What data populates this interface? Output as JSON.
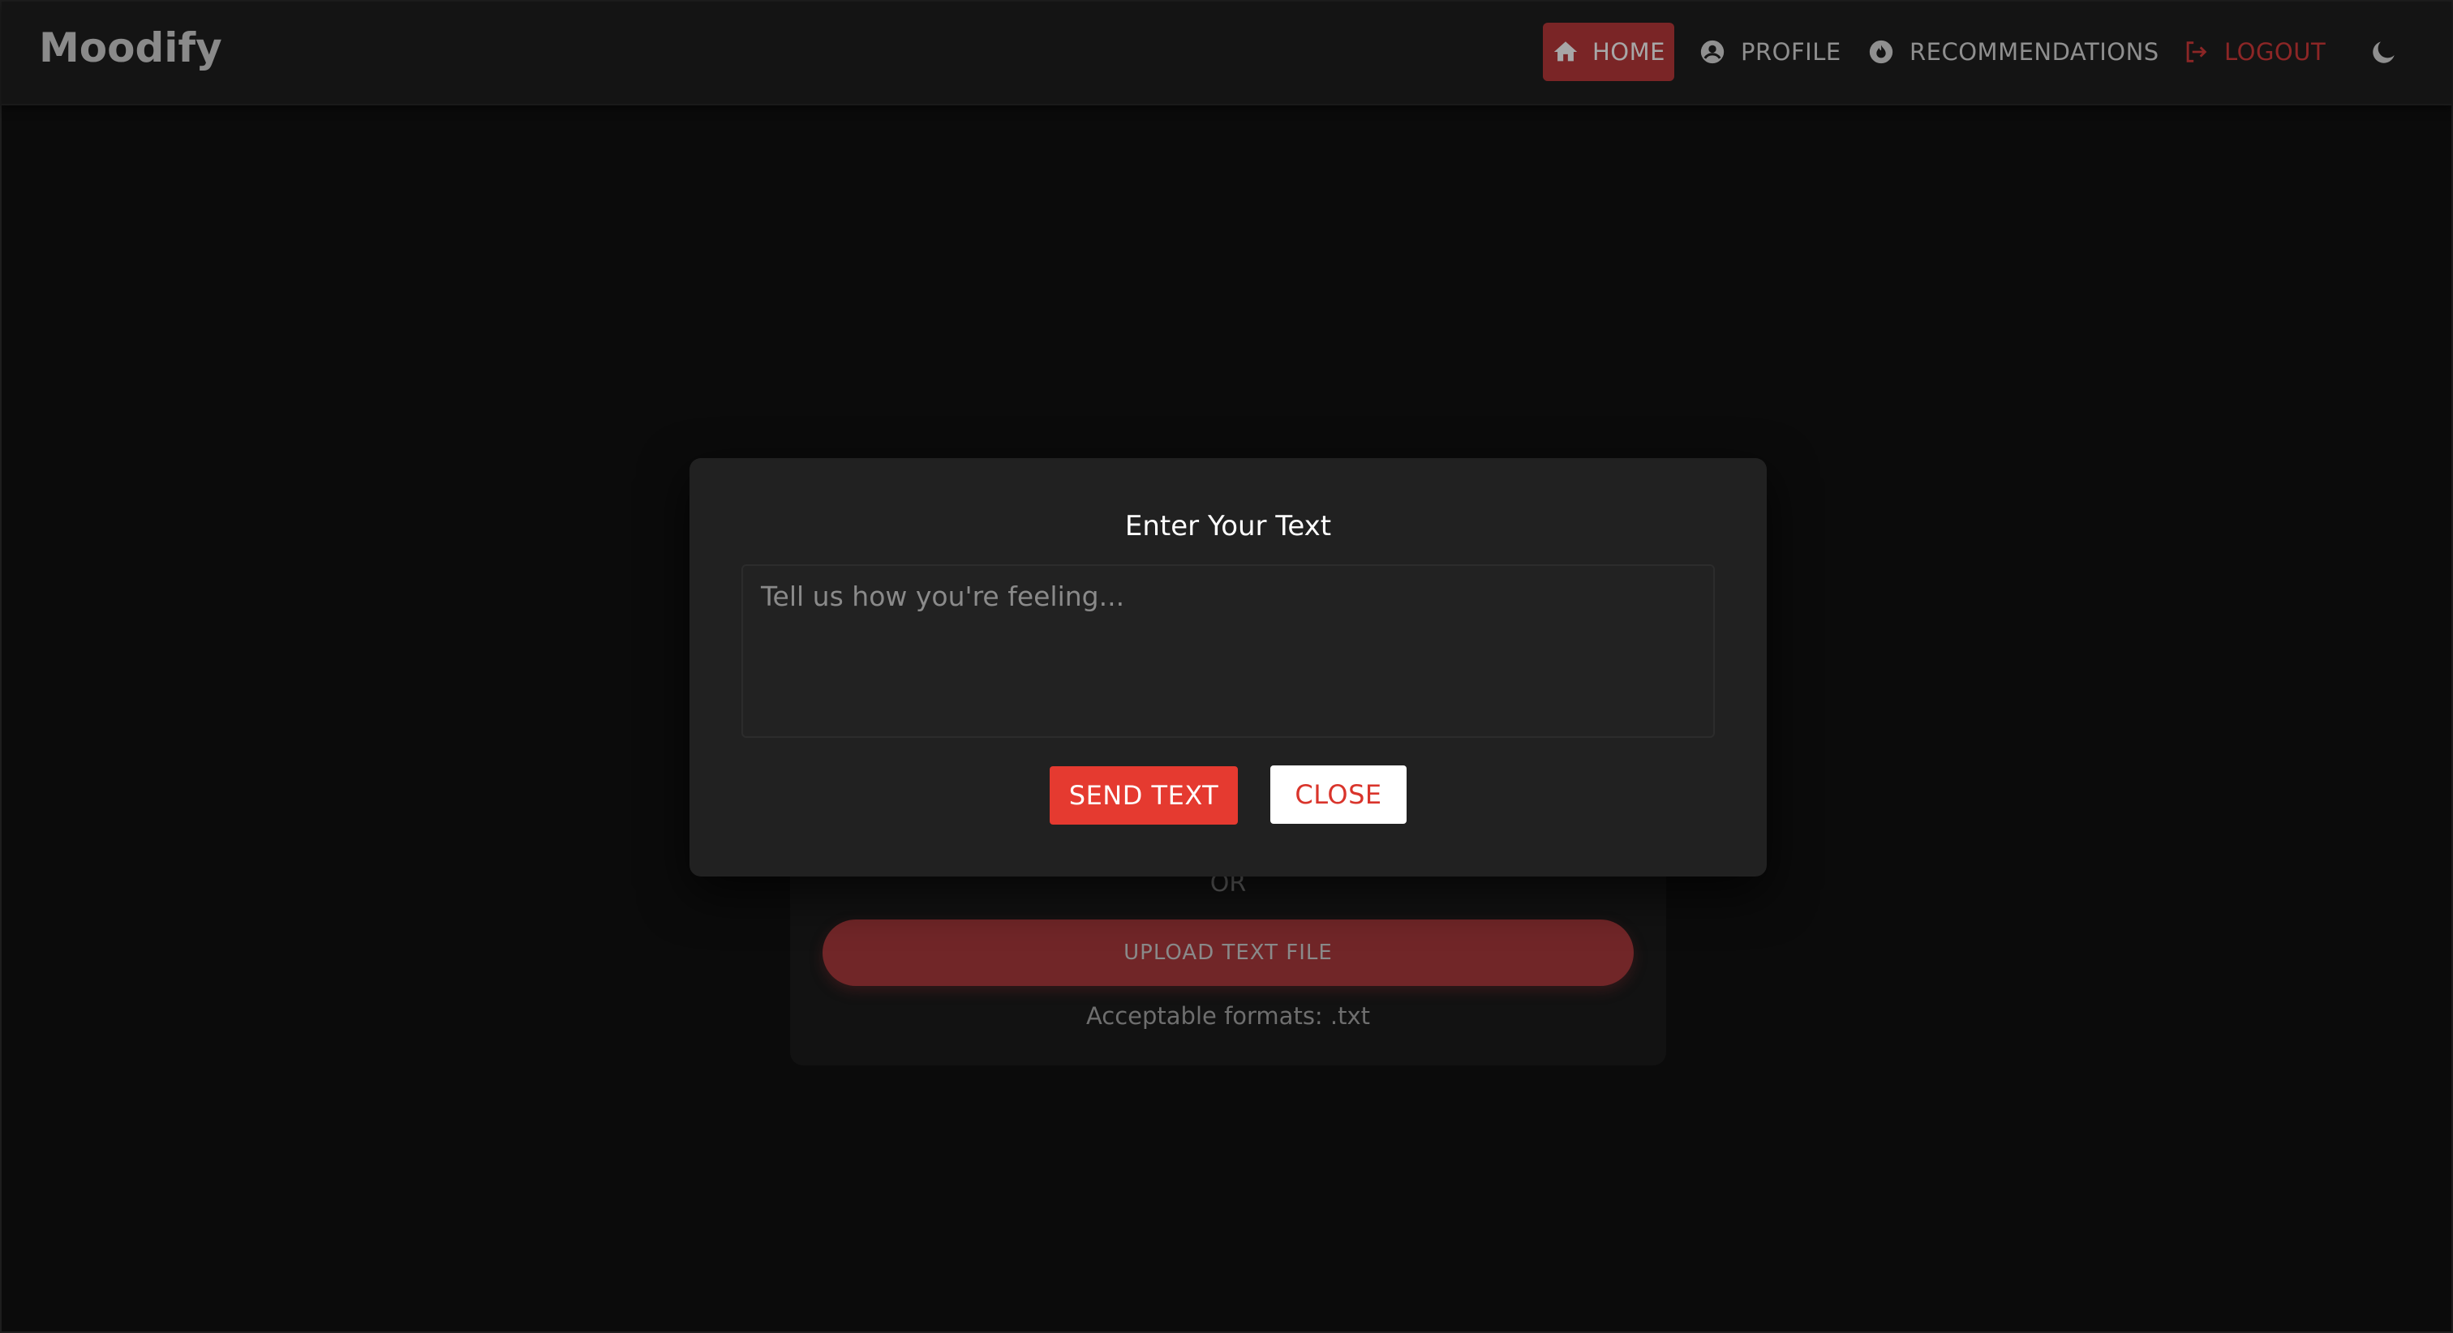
{
  "app": {
    "brand": "Moodify"
  },
  "nav": {
    "home": "HOME",
    "profile": "PROFILE",
    "recommendations": "RECOMMENDATIONS",
    "logout": "LOGOUT"
  },
  "background_card": {
    "or_label": "OR",
    "upload_label": "UPLOAD TEXT FILE",
    "formats_label": "Acceptable formats: .txt"
  },
  "modal": {
    "title": "Enter Your Text",
    "textarea_placeholder": "Tell us how you're feeling...",
    "textarea_value": "",
    "send_label": "SEND TEXT",
    "close_label": "CLOSE"
  },
  "colors": {
    "accent": "#e53a30",
    "active_nav_bg": "#7a2526",
    "logout": "#8c2626",
    "modal_bg": "#212121",
    "page_bg": "#0b0b0b"
  },
  "icons": {
    "home": "home-icon",
    "profile": "account-circle-icon",
    "recommendations": "fire-icon",
    "logout": "logout-icon",
    "theme": "moon-icon"
  }
}
